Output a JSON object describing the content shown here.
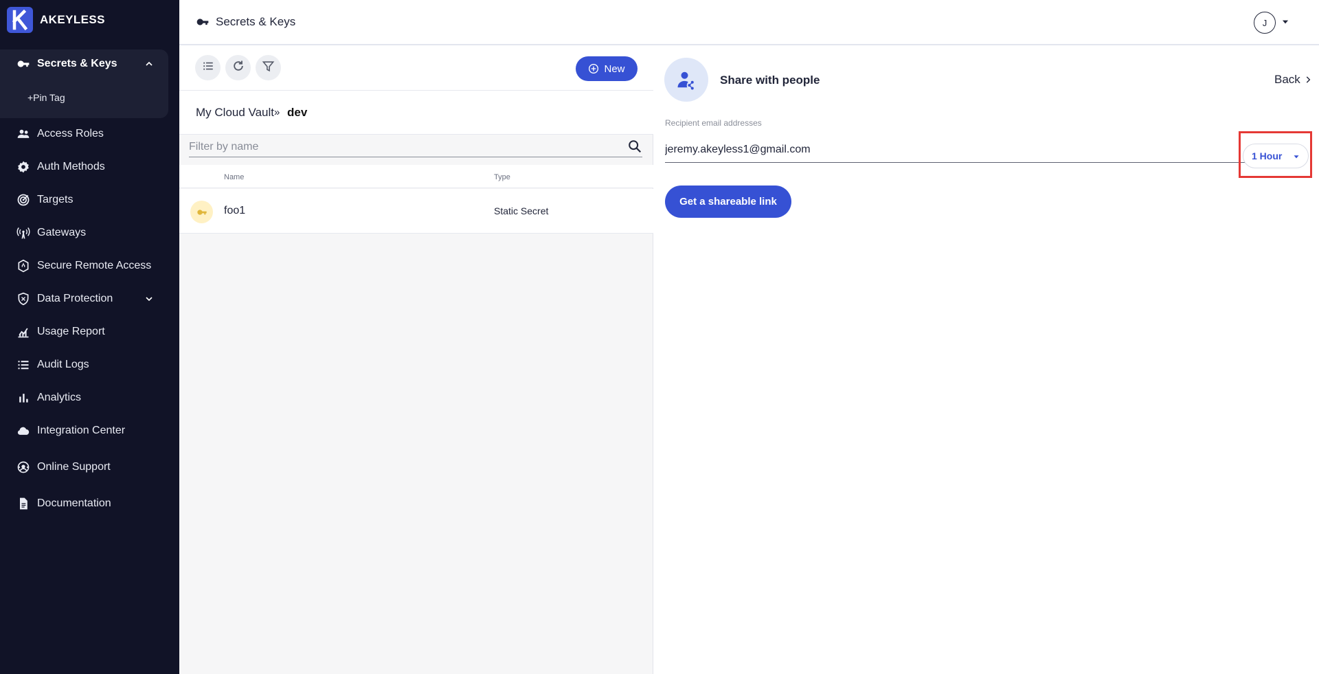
{
  "brand": {
    "name": "AKEYLESS"
  },
  "sidebar": {
    "active_section": "Secrets & Keys",
    "pin_tag": "+Pin Tag",
    "items": [
      {
        "label": "Access Roles",
        "icon": "people-icon"
      },
      {
        "label": "Auth Methods",
        "icon": "gear-shield-icon"
      },
      {
        "label": "Targets",
        "icon": "target-icon"
      },
      {
        "label": "Gateways",
        "icon": "antenna-icon"
      },
      {
        "label": "Secure Remote Access",
        "icon": "shield-lock-icon"
      },
      {
        "label": "Data Protection",
        "icon": "shield-icon"
      },
      {
        "label": "Usage Report",
        "icon": "chart-icon"
      },
      {
        "label": "Audit Logs",
        "icon": "list-icon"
      },
      {
        "label": "Analytics",
        "icon": "bar-chart-icon"
      },
      {
        "label": "Integration Center",
        "icon": "cloud-icon"
      },
      {
        "label": "Online Support",
        "icon": "support-icon"
      },
      {
        "label": "Documentation",
        "icon": "document-icon"
      }
    ]
  },
  "header": {
    "title": "Secrets & Keys",
    "avatar_initial": "J"
  },
  "list": {
    "new_label": "New",
    "breadcrumb": {
      "root": "My Cloud Vault",
      "separator": "»",
      "current": "dev"
    },
    "filter_placeholder": "Filter by name",
    "columns": {
      "name": "Name",
      "type": "Type"
    },
    "rows": [
      {
        "name": "foo1",
        "type": "Static Secret"
      }
    ]
  },
  "share": {
    "title": "Share with people",
    "back_label": "Back",
    "email_label": "Recipient email addresses",
    "email_value": "jeremy.akeyless1@gmail.com",
    "duration_value": "1 Hour",
    "share_button_label": "Get a shareable link"
  },
  "colors": {
    "sidebar_bg": "#111327",
    "accent": "#3651d4",
    "highlight": "#e53935"
  }
}
